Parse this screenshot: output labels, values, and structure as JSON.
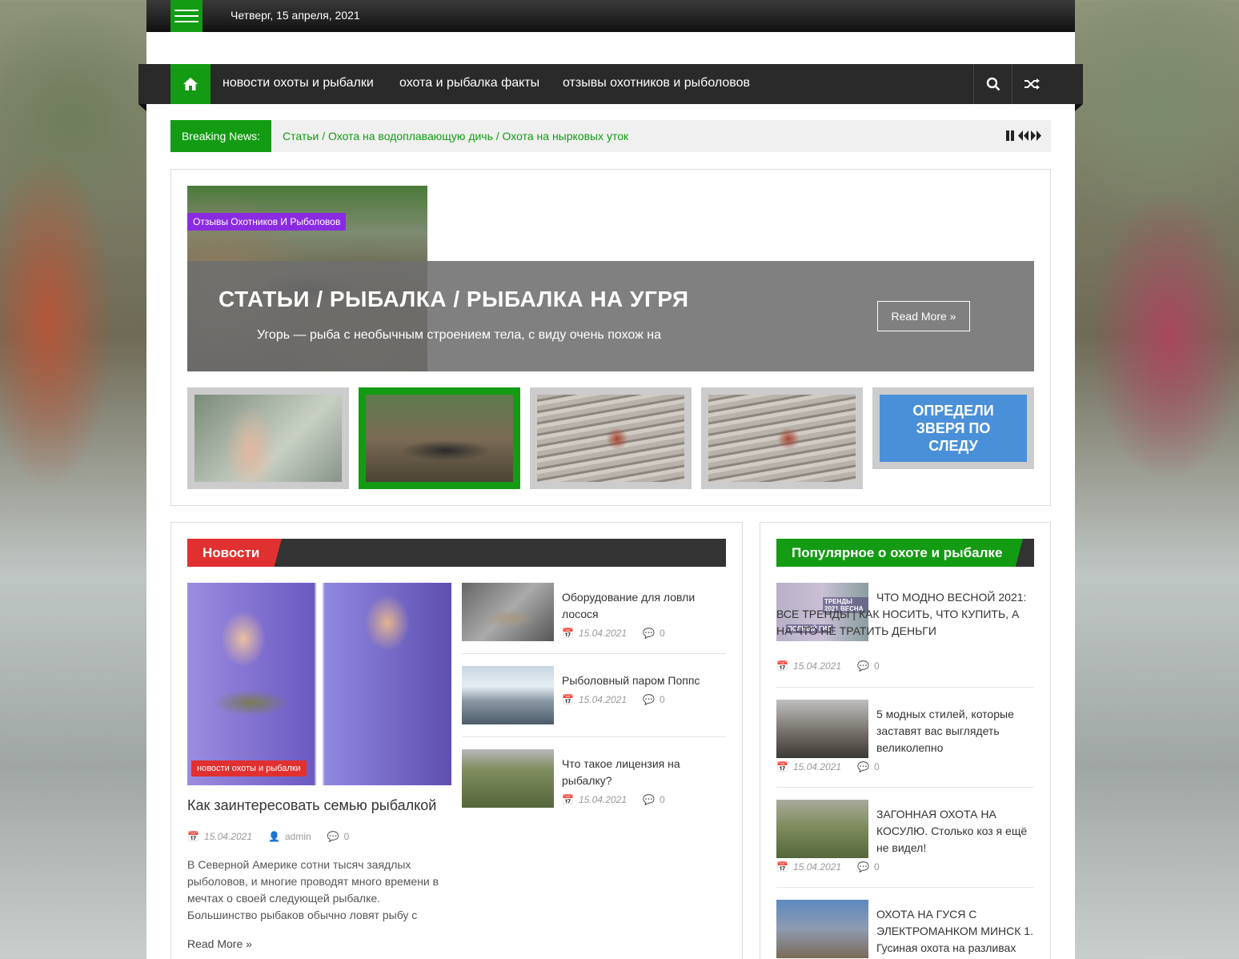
{
  "topbar": {
    "date": "Четверг, 15 апреля, 2021"
  },
  "nav": {
    "items": [
      "новости охоты и рыбалки",
      "охота и рыбалка факты",
      "отзывы охотников и рыболовов"
    ]
  },
  "ticker": {
    "label": "Breaking News:",
    "text": "Статьи / Охота на водоплавающую дичь / Охота на нырковых уток"
  },
  "slider": {
    "category": "Отзывы Охотников И Рыболовов",
    "title": "СТАТЬИ / РЫБАЛКА / РЫБАЛКА НА УГРЯ",
    "excerpt": "Угорь — рыба с необычным строением тела, с виду очень похож на",
    "read_more": "Read More",
    "banner": "ОПРЕДЕЛИ ЗВЕРЯ ПО СЛЕДУ"
  },
  "news": {
    "heading": "Новости",
    "main": {
      "category": "новости охоты и рыбалки",
      "title": "Как заинтересовать семью рыбалкой",
      "date": "15.04.2021",
      "author": "admin",
      "comments": "0",
      "excerpt": "В Северной Америке сотни тысяч заядлых рыболовов, и многие проводят много времени в мечтах о своей следующей рыбалке. Большинство рыбаков обычно ловят рыбу с",
      "read_more": "Read More"
    },
    "items": [
      {
        "title": "Оборудование для ловли лосося",
        "date": "15.04.2021",
        "comments": "0"
      },
      {
        "title": "Рыболовный паром Поппс",
        "date": "15.04.2021",
        "comments": "0"
      },
      {
        "title": "Что такое лицензия на рыбалку?",
        "date": "15.04.2021",
        "comments": "0"
      }
    ]
  },
  "popular": {
    "heading": "Популярное о охоте и рыбалке",
    "items": [
      {
        "title": "ЧТО МОДНО ВЕСНОЙ 2021: ВСЕ ТРЕНДЫ | КАК НОСИТЬ, ЧТО КУПИТЬ, А НА ЧТО НЕ ТРАТИТЬ ДЕНЬГИ",
        "date": "15.04.2021",
        "comments": "0",
        "thumb_text": "ТРЕНДЫ 2021 ВЕСНА",
        "thumb_text2": "ПОЛНЫЙ ГИД"
      },
      {
        "title": "5 модных стилей, которые заставят вас выглядеть великолепно",
        "date": "15.04.2021",
        "comments": "0"
      },
      {
        "title": "ЗАГОННАЯ ОХОТА НА КОСУЛЮ. Столько коз я ещё не видел!",
        "date": "15.04.2021",
        "comments": "0"
      },
      {
        "title": "ОХОТА НА ГУСЯ С ЭЛЕКТРОМАНКОМ МИНСК 1. Гусиная охота на разливах",
        "date": "",
        "comments": ""
      }
    ]
  },
  "colors": {
    "accent": "#139c13",
    "news_tab": "#e03030",
    "slide_category": "#8a2be2"
  }
}
